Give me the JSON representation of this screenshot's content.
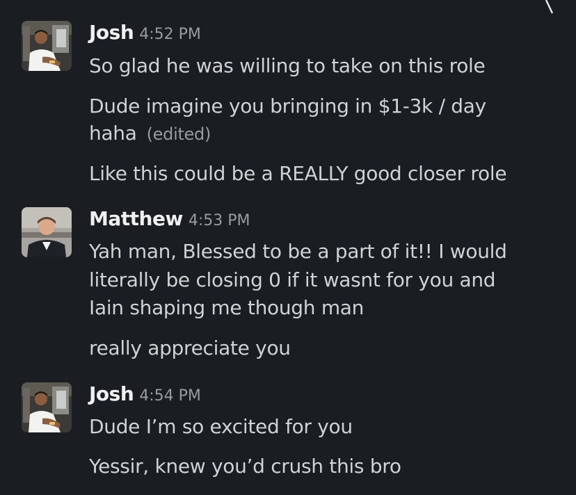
{
  "conversation": {
    "groups": [
      {
        "sender": "Josh",
        "time": "4:52 PM",
        "avatar_icon": "person-avatar-icon",
        "messages": [
          {
            "lines": [
              "So glad he was willing to take on this role"
            ]
          },
          {
            "lines": [
              "Dude imagine you bringing in $1-3k / day",
              "haha"
            ],
            "edited_label": "(edited)"
          },
          {
            "lines": [
              "Like this could be a REALLY good closer role"
            ]
          }
        ]
      },
      {
        "sender": "Matthew",
        "time": "4:53 PM",
        "avatar_icon": "person-avatar-icon",
        "messages": [
          {
            "lines": [
              "Yah man,  Blessed to be a part of it!! I would",
              "literally be closing 0 if it wasnt for you and",
              "Iain shaping me though man"
            ]
          },
          {
            "lines": [
              "really appreciate you"
            ]
          }
        ]
      },
      {
        "sender": "Josh",
        "time": "4:54 PM",
        "avatar_icon": "person-avatar-icon",
        "messages": [
          {
            "lines": [
              "Dude I’m so excited for you"
            ]
          },
          {
            "lines": [
              "Yessir, knew you’d crush this bro"
            ]
          }
        ]
      }
    ]
  },
  "colors": {
    "background": "#1a1d21",
    "sender_name": "#f0f0f1",
    "message_text": "#d1d2d3",
    "timestamp": "#9a9b9e"
  }
}
